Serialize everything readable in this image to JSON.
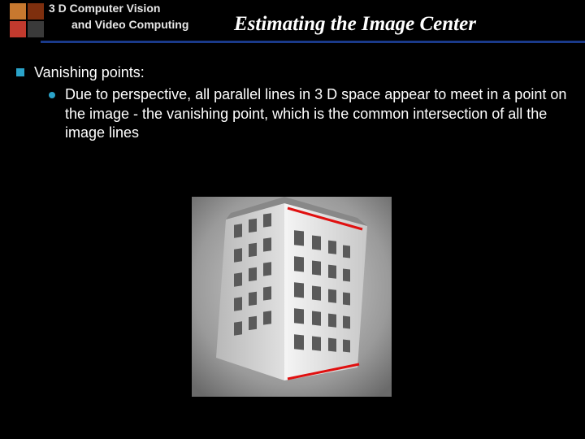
{
  "header": {
    "line1": "3 D Computer Vision",
    "line2": "and Video Computing",
    "title": "Estimating the Image Center"
  },
  "content": {
    "bullet1": "Vanishing points:",
    "sub1": "Due to perspective, all parallel lines in 3 D space appear to meet in a point on the image - the vanishing point, which is the common intersection of all the image lines"
  }
}
